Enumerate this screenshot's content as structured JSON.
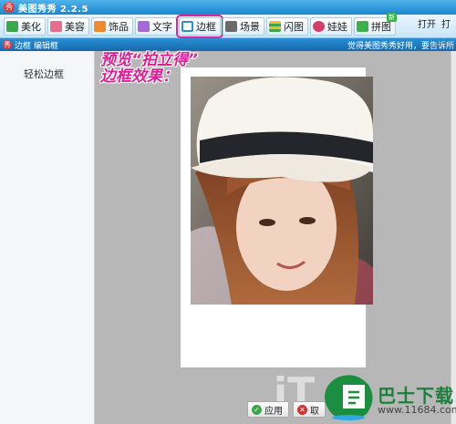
{
  "app": {
    "title": "美图秀秀 2.2.5",
    "icon_label": "秀"
  },
  "toolbar": {
    "items": [
      {
        "label": "美化",
        "icon": "image-icon",
        "color": "#3aa84a"
      },
      {
        "label": "美容",
        "icon": "face-icon",
        "color": "#e86c8b"
      },
      {
        "label": "饰品",
        "icon": "heart-icon",
        "color": "#f08a2c"
      },
      {
        "label": "文字",
        "icon": "text-icon",
        "color": "#a56ad8"
      },
      {
        "label": "边框",
        "icon": "frame-icon",
        "color": "#2b8fd4",
        "active": true
      },
      {
        "label": "场景",
        "icon": "scene-icon",
        "color": "#6a6a6a"
      },
      {
        "label": "闪图",
        "icon": "flash-icon",
        "color": "#e8c12a"
      },
      {
        "label": "娃娃",
        "icon": "doll-icon",
        "color": "#d43f6a"
      },
      {
        "label": "拼图",
        "icon": "puzzle-icon",
        "color": "#3db04c",
        "badge": "新"
      }
    ],
    "open_label": "打开",
    "open2_label": "打"
  },
  "subbar": {
    "breadcrumb": "边框 编辑框",
    "right_text": "觉得美图秀秀好用，要告诉所"
  },
  "sidebar": {
    "item": "轻松边框"
  },
  "annotation": {
    "line1": "预览“拍立得”",
    "line2": "边框效果："
  },
  "actions": {
    "apply": "应用",
    "cancel": "取"
  },
  "watermark": {
    "it": "iT",
    "site_name": "巴士下载",
    "site_url": "www.11684.com"
  },
  "colors": {
    "accent": "#1a86cf",
    "highlight": "#d92a9d",
    "workspace": "#b7b7b7"
  }
}
